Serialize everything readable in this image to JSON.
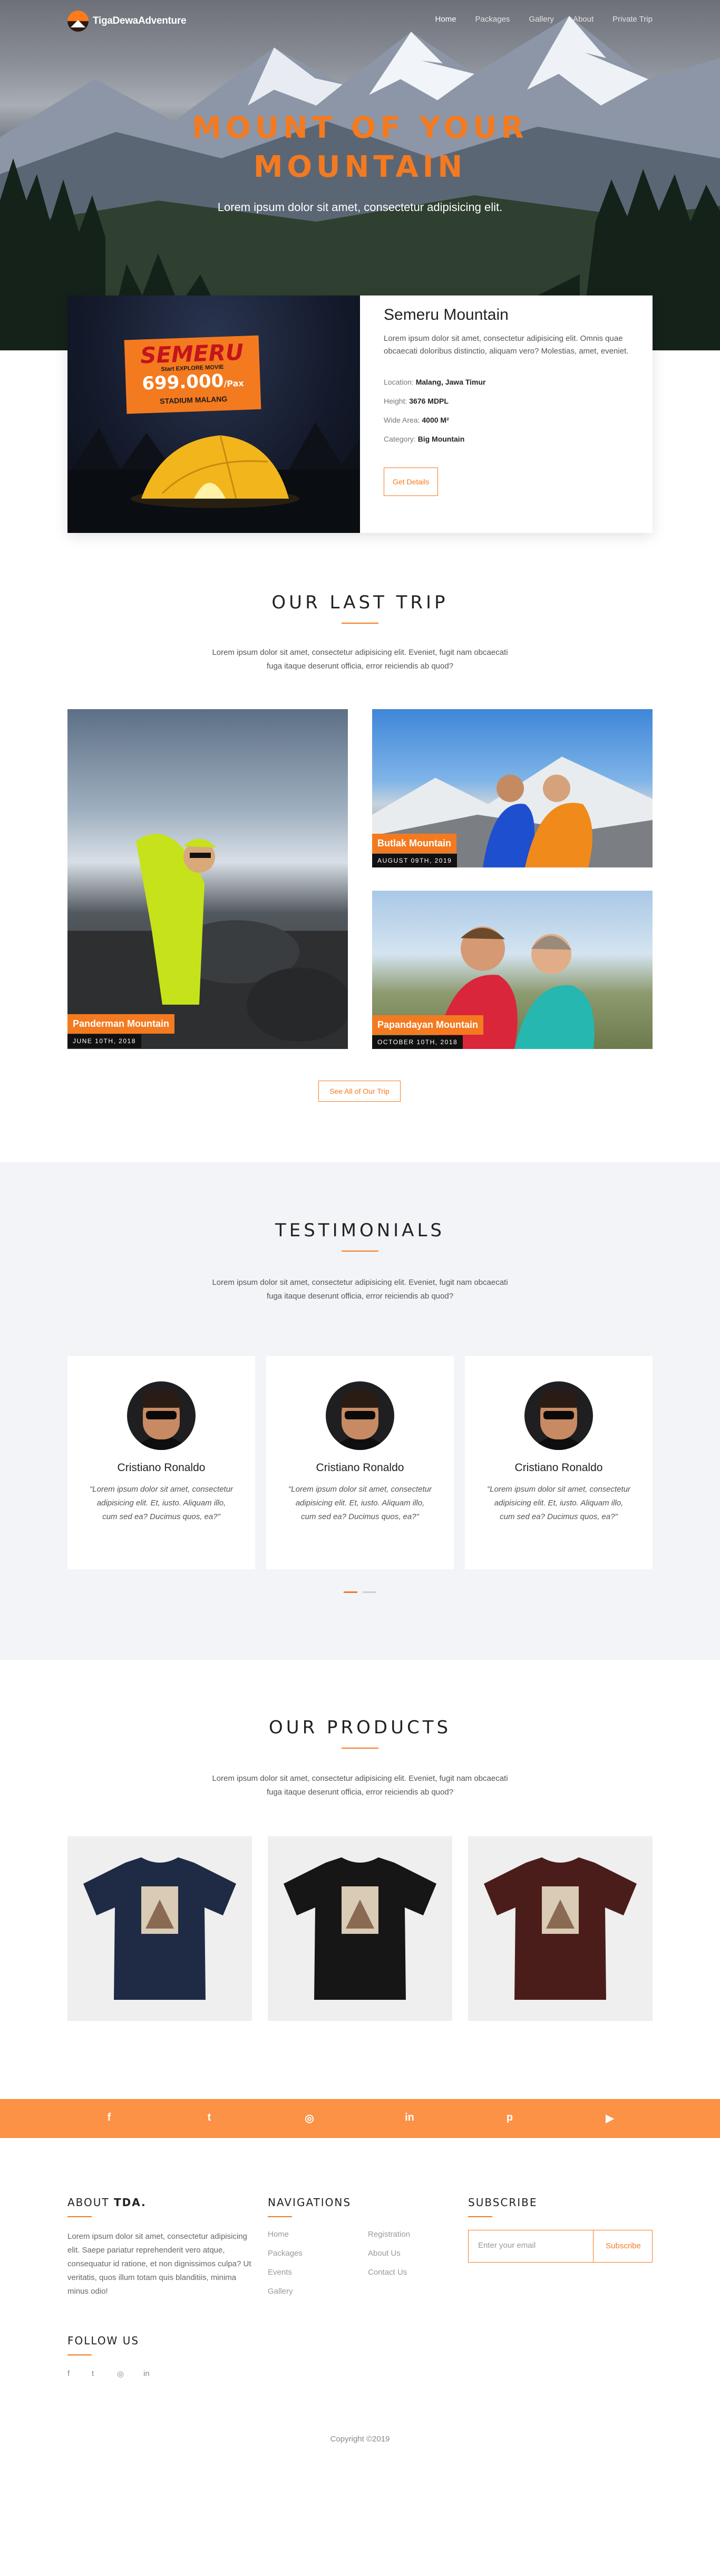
{
  "nav": {
    "brand": "TigaDewaAdventure",
    "items": [
      "Home",
      "Packages",
      "Gallery",
      "About",
      "Private Trip"
    ],
    "active": "Home"
  },
  "hero": {
    "title_line1": "MOUNT OF YOUR",
    "title_line2": "MOUNTAIN",
    "subtitle": "Lorem ipsum dolor sit amet, consectetur adipisicing elit."
  },
  "feature": {
    "title": "Semeru Mountain",
    "description": "Lorem ipsum dolor sit amet, consectetur adipisicing elit. Omnis quae obcaecati doloribus distinctio, aliquam vero? Molestias, amet, eveniet.",
    "location_label": "Location:",
    "location_value": "Malang, Jawa Timur",
    "height_label": "Height:",
    "height_value": "3676 MDPL",
    "area_label": "Wide Area:",
    "area_value": "4000 M²",
    "category_label": "Category:",
    "category_value": "Big Mountain",
    "button": "Get Details",
    "poster": {
      "title": "SEMERU",
      "subtitle": "Start EXPLORE MOVIE",
      "price": "699.000",
      "price_unit": "/Pax",
      "venue": "STADIUM MALANG"
    }
  },
  "last_trip": {
    "title": "OUR LAST TRIP",
    "description": "Lorem ipsum dolor sit amet, consectetur adipisicing elit. Eveniet, fugit nam obcaecati fuga itaque deserunt officia, error reiciendis ab quod?",
    "trips": [
      {
        "name": "Panderman Mountain",
        "date": "JUNE 10TH, 2018"
      },
      {
        "name": "Butlak Mountain",
        "date": "AUGUST 09TH, 2019"
      },
      {
        "name": "Papandayan Mountain",
        "date": "OCTOBER 10TH, 2018"
      }
    ],
    "button": "See All of Our Trip"
  },
  "testimonials": {
    "title": "TESTIMONIALS",
    "description": "Lorem ipsum dolor sit amet, consectetur adipisicing elit. Eveniet, fugit nam obcaecati fuga itaque deserunt officia, error reiciendis ab quod?",
    "items": [
      {
        "name": "Cristiano Ronaldo",
        "quote": "\"Lorem ipsum dolor sit amet, consectetur adipisicing elit. Et, iusto. Aliquam illo, cum sed ea? Ducimus quos, ea?\""
      },
      {
        "name": "Cristiano Ronaldo",
        "quote": "\"Lorem ipsum dolor sit amet, consectetur adipisicing elit. Et, iusto. Aliquam illo, cum sed ea? Ducimus quos, ea?\""
      },
      {
        "name": "Cristiano Ronaldo",
        "quote": "\"Lorem ipsum dolor sit amet, consectetur adipisicing elit. Et, iusto. Aliquam illo, cum sed ea? Ducimus quos, ea?\""
      }
    ]
  },
  "products": {
    "title": "OUR PRODUCTS",
    "description": "Lorem ipsum dolor sit amet, consectetur adipisicing elit. Eveniet, fugit nam obcaecati fuga itaque deserunt officia, error reiciendis ab quod?",
    "shirt_colors": [
      "#1f2b45",
      "#161616",
      "#4a1d1b"
    ]
  },
  "social": {
    "icons": [
      "facebook-icon",
      "twitter-icon",
      "instagram-icon",
      "linkedin-icon",
      "pinterest-icon",
      "youtube-icon"
    ],
    "glyphs": [
      "f",
      "t",
      "◎",
      "in",
      "p",
      "▶"
    ]
  },
  "footer": {
    "about_title": "ABOUT",
    "about_brand": "TDA.",
    "about_text": "Lorem ipsum dolor sit amet, consectetur adipisicing elit. Saepe pariatur reprehenderit vero atque, consequatur id ratione, et non dignissimos culpa? Ut veritatis, quos illum totam quis blanditiis, minima minus odio!",
    "nav_title": "NAVIGATIONS",
    "nav_col1": [
      "Home",
      "Packages",
      "Events",
      "Gallery"
    ],
    "nav_col2": [
      "Registration",
      "About Us",
      "Contact Us"
    ],
    "subscribe_title": "SUBSCRIBE",
    "subscribe_placeholder": "Enter your email",
    "subscribe_button": "Subscribe",
    "follow_title": "FOLLOW US",
    "follow_glyphs": [
      "f",
      "t",
      "◎",
      "in"
    ],
    "copyright": "Copyright ©2019"
  },
  "colors": {
    "accent": "#f47a20",
    "social_bar": "#fb9245",
    "testimonials_bg": "#f3f4f7"
  }
}
